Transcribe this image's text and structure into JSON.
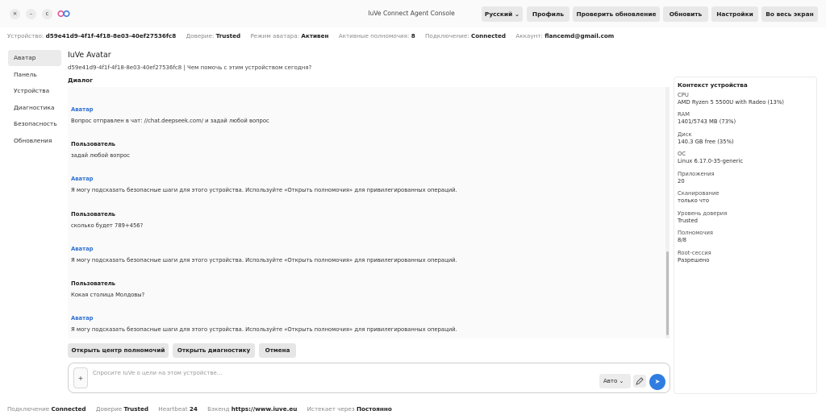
{
  "window": {
    "title": "IuVe Connect Agent Console",
    "controls": {
      "close": "×",
      "minimize": "–",
      "reload": "c"
    }
  },
  "toolbar": {
    "language": "Русский",
    "profile": "Профиль",
    "check_update": "Проверить обновление",
    "refresh": "Обновить",
    "settings": "Настройки",
    "fullscreen": "Во весь экран"
  },
  "infobar": {
    "device_label": "Устройство:",
    "device_value": "d59e41d9-4f1f-4f18-8e03-40ef27536fc8",
    "trust_label": "Доверие:",
    "trust_value": "Trusted",
    "avatar_mode_label": "Режим аватара:",
    "avatar_mode_value": "Активен",
    "active_perms_label": "Активные полномочия:",
    "active_perms_value": "8",
    "connection_label": "Подключение:",
    "connection_value": "Connected",
    "account_label": "Аккаунт:",
    "account_value": "flancemd@gmail.com"
  },
  "sidebar": {
    "items": [
      {
        "label": "Аватар",
        "active": true
      },
      {
        "label": "Панель",
        "active": false
      },
      {
        "label": "Устройства",
        "active": false
      },
      {
        "label": "Диагностика",
        "active": false
      },
      {
        "label": "Безопасность",
        "active": false
      },
      {
        "label": "Обновления",
        "active": false
      }
    ]
  },
  "main": {
    "title": "IuVe Avatar",
    "subtitle": "d59e41d9-4f1f-4f18-8e03-40ef27536fc8 | Чем помочь с этим устройством сегодня?",
    "dialog_label": "Диалог"
  },
  "messages": [
    {
      "author": "Аватар",
      "role": "bot",
      "text": "Вопрос отправлен в чат: //chat.deepseek.com/ и задай любой вопрос"
    },
    {
      "author": "Пользователь",
      "role": "user",
      "text": "задай любой вопрос"
    },
    {
      "author": "Аватар",
      "role": "bot",
      "text": "Я могу подсказать безопасные шаги для этого устройства. Используйте «Открыть полномочия» для привилегированных операций."
    },
    {
      "author": "Пользователь",
      "role": "user",
      "text": "сколько будет 789+456?"
    },
    {
      "author": "Аватар",
      "role": "bot",
      "text": "Я могу подсказать безопасные шаги для этого устройства. Используйте «Открыть полномочия» для привилегированных операций."
    },
    {
      "author": "Пользователь",
      "role": "user",
      "text": "Кокая столица Молдовы?"
    },
    {
      "author": "Аватар",
      "role": "bot",
      "text": "Я могу подсказать безопасные шаги для этого устройства. Используйте «Открыть полномочия» для привилегированных операций."
    }
  ],
  "quick_actions": {
    "open_permissions": "Открыть центр полномочий",
    "open_diagnostics": "Открыть диагностику",
    "cancel": "Отмена"
  },
  "composer": {
    "plus": "+",
    "placeholder": "Спросите IuVe о цели на этом устройстве...",
    "mode": "Авто",
    "send": "➤"
  },
  "context_panel": {
    "title": "Контекст устройства",
    "items": [
      {
        "key": "CPU",
        "value": "AMD Ryzen 5 5500U with Radeo (13%)"
      },
      {
        "key": "RAM",
        "value": "1401/5743 MB (73%)"
      },
      {
        "key": "Диск",
        "value": "140.3 GB free (35%)"
      },
      {
        "key": "ОС",
        "value": "Linux 6.17.0-35-generic"
      },
      {
        "key": "Приложения",
        "value": "20"
      },
      {
        "key": "Сканирование",
        "value": "только что"
      },
      {
        "key": "Уровень доверия",
        "value": "Trusted"
      },
      {
        "key": "Полномочия",
        "value": "8/8"
      },
      {
        "key": "Root-сессия",
        "value": "Разрешено"
      }
    ]
  },
  "statusbar": {
    "connection_label": "Подключение",
    "connection_value": "Connected",
    "trust_label": "Доверие",
    "trust_value": "Trusted",
    "heartbeat_label": "Heartbeat",
    "heartbeat_value": "24",
    "backend_label": "Бэкенд",
    "backend_value": "https://www.iuve.eu",
    "expires_label": "Истекает через",
    "expires_value": "Постоянно"
  },
  "colors": {
    "accent": "#2f7de1",
    "bot_name": "#2f6fcf",
    "button_bg": "#e8e8e8"
  }
}
